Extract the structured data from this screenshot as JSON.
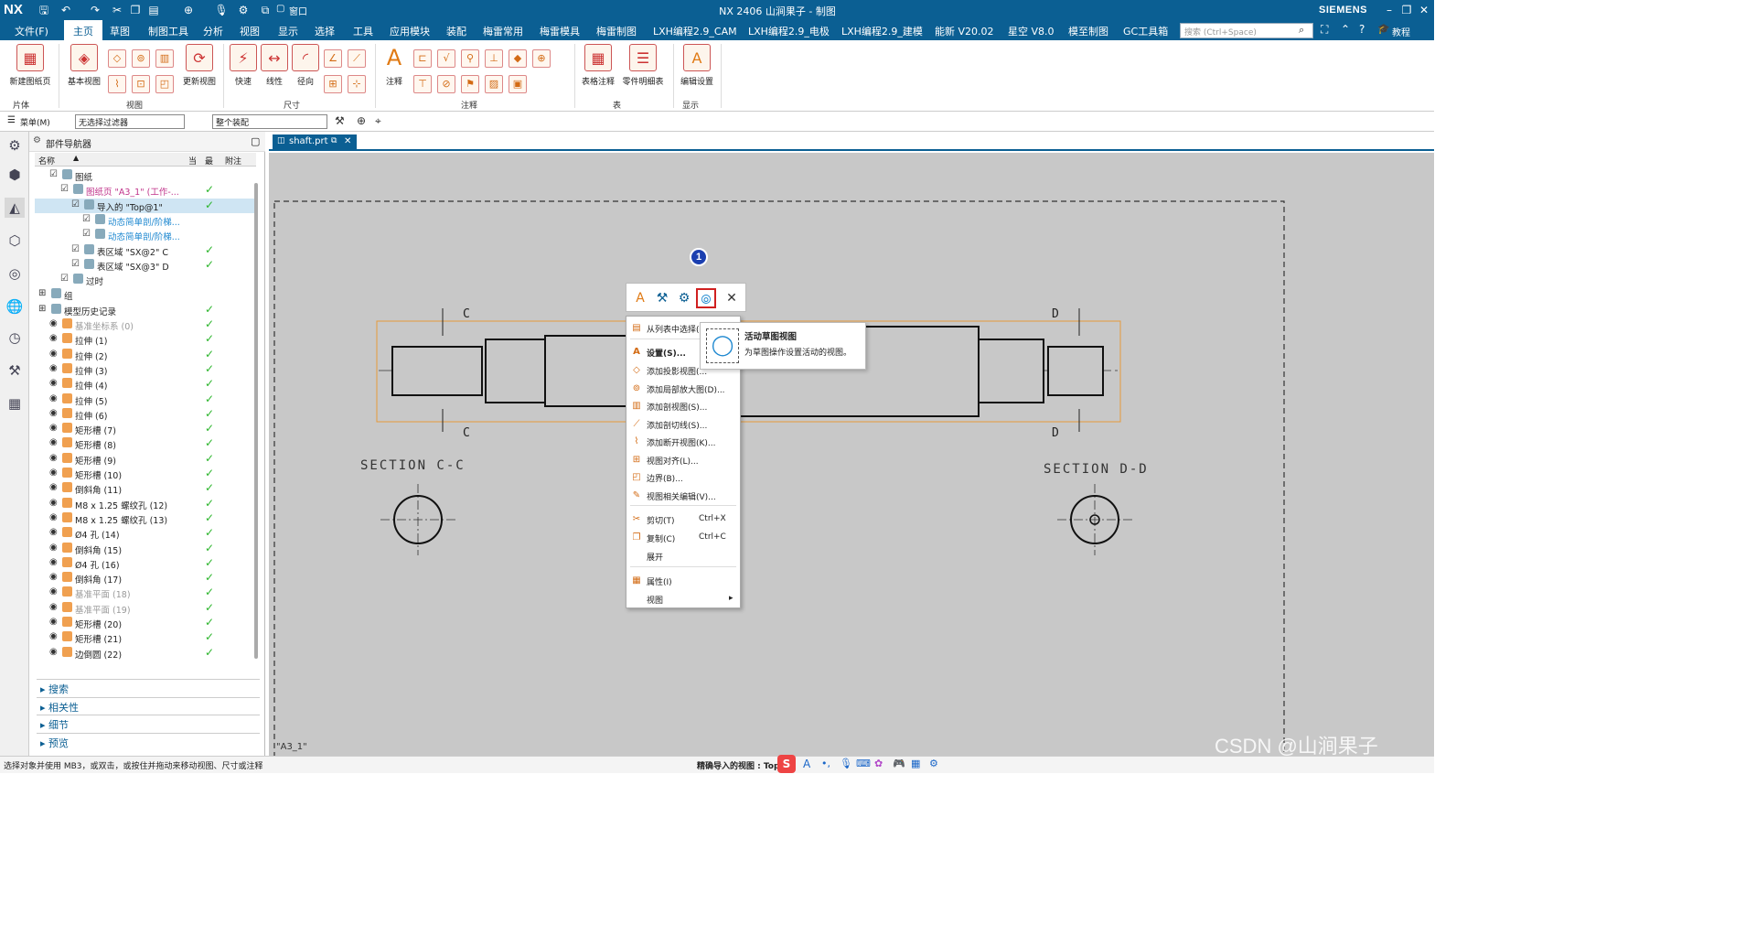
{
  "titlebar": {
    "logo": "NX",
    "title": "NX 2406 山涧果子 - 制图",
    "brand": "SIEMENS",
    "window_menu": "窗口"
  },
  "menubar": {
    "items": [
      "文件(F)",
      "主页",
      "草图",
      "制图工具",
      "分析",
      "视图",
      "显示",
      "选择",
      "工具",
      "应用模块",
      "装配",
      "梅雷常用",
      "梅雷模具",
      "梅雷制图",
      "LXH编程2.9_CAM",
      "LXH编程2.9_电极",
      "LXH编程2.9_建模",
      "能新 V20.02",
      "星空 V8.0",
      "模至制图",
      "GC工具箱"
    ],
    "active": "主页",
    "search_placeholder": "搜索 (Ctrl+Space)",
    "tutorial": "教程"
  },
  "ribbon": {
    "buttons": {
      "new_sheet": "新建图纸页",
      "base_view": "基本视图",
      "update_view": "更新视图",
      "quick": "快速",
      "linear": "线性",
      "radial": "径向",
      "note": "注释",
      "table_note": "表格注释",
      "parts_list": "零件明细表",
      "edit_settings": "编辑设置"
    },
    "groups": {
      "sheet": "片体",
      "view": "视图",
      "dimension": "尺寸",
      "annotation": "注释",
      "table": "表",
      "display": "显示"
    }
  },
  "toolrow": {
    "menu": "菜单(M)",
    "filter": "无选择过滤器",
    "scope": "整个装配"
  },
  "navigator": {
    "title": "部件导航器",
    "columns": {
      "name": "名称",
      "current": "当",
      "latest": "最",
      "notes": "附注"
    },
    "rows": [
      {
        "label": "图纸",
        "indent": 1,
        "check": false
      },
      {
        "label": "图纸页 \"A3_1\" (工作-...",
        "indent": 2,
        "check": true,
        "color": "#c0338a"
      },
      {
        "label": "导入的 \"Top@1\"",
        "indent": 3,
        "check": true,
        "selected": true
      },
      {
        "label": "动态简单剖/阶梯...",
        "indent": 4,
        "check": false,
        "color": "#1e88d0"
      },
      {
        "label": "动态简单剖/阶梯...",
        "indent": 4,
        "check": false,
        "color": "#1e88d0"
      },
      {
        "label": "表区域 \"SX@2\" C",
        "indent": 3,
        "check": true
      },
      {
        "label": "表区域 \"SX@3\" D",
        "indent": 3,
        "check": true
      },
      {
        "label": "过时",
        "indent": 2,
        "check": false
      },
      {
        "label": "组",
        "indent": 0,
        "check": false
      },
      {
        "label": "模型历史记录",
        "indent": 0,
        "check": true
      },
      {
        "label": "基准坐标系 (0)",
        "indent": 1,
        "check": true,
        "color": "#999"
      },
      {
        "label": "拉伸 (1)",
        "indent": 1,
        "check": true
      },
      {
        "label": "拉伸 (2)",
        "indent": 1,
        "check": true
      },
      {
        "label": "拉伸 (3)",
        "indent": 1,
        "check": true
      },
      {
        "label": "拉伸 (4)",
        "indent": 1,
        "check": true
      },
      {
        "label": "拉伸 (5)",
        "indent": 1,
        "check": true
      },
      {
        "label": "拉伸 (6)",
        "indent": 1,
        "check": true
      },
      {
        "label": "矩形槽 (7)",
        "indent": 1,
        "check": true
      },
      {
        "label": "矩形槽 (8)",
        "indent": 1,
        "check": true
      },
      {
        "label": "矩形槽 (9)",
        "indent": 1,
        "check": true
      },
      {
        "label": "矩形槽 (10)",
        "indent": 1,
        "check": true
      },
      {
        "label": "倒斜角 (11)",
        "indent": 1,
        "check": true
      },
      {
        "label": "M8 x 1.25 螺纹孔 (12)",
        "indent": 1,
        "check": true
      },
      {
        "label": "M8 x 1.25 螺纹孔 (13)",
        "indent": 1,
        "check": true
      },
      {
        "label": "Ø4 孔 (14)",
        "indent": 1,
        "check": true
      },
      {
        "label": "倒斜角 (15)",
        "indent": 1,
        "check": true
      },
      {
        "label": "Ø4 孔 (16)",
        "indent": 1,
        "check": true
      },
      {
        "label": "倒斜角 (17)",
        "indent": 1,
        "check": true
      },
      {
        "label": "基准平面 (18)",
        "indent": 1,
        "check": true,
        "color": "#999"
      },
      {
        "label": "基准平面 (19)",
        "indent": 1,
        "check": true,
        "color": "#999"
      },
      {
        "label": "矩形槽 (20)",
        "indent": 1,
        "check": true
      },
      {
        "label": "矩形槽 (21)",
        "indent": 1,
        "check": true
      },
      {
        "label": "边倒圆 (22)",
        "indent": 1,
        "check": true
      }
    ],
    "panels": [
      "搜索",
      "相关性",
      "细节",
      "预览"
    ]
  },
  "tab": {
    "name": "shaft.prt"
  },
  "drawing": {
    "sheet_label": "\"A3_1\"",
    "section_c": "SECTION C-C",
    "section_d": "SECTION D-D",
    "mark_c": "C",
    "mark_d": "D"
  },
  "popup": {
    "badge": "1",
    "tooltip_title": "活动草图视图",
    "tooltip_desc": "为草图操作设置活动的视图。",
    "menu": [
      {
        "label": "从列表中选择(...",
        "icon": "list-icon"
      },
      {
        "label": "设置(S)...",
        "icon": "settings-icon",
        "bold": true
      },
      {
        "label": "添加投影视图(...",
        "icon": "projected-view-icon"
      },
      {
        "label": "添加局部放大图(D)...",
        "icon": "detail-view-icon"
      },
      {
        "label": "添加剖视图(S)...",
        "icon": "section-view-icon"
      },
      {
        "label": "添加剖切线(S)...",
        "icon": "cut-line-icon"
      },
      {
        "label": "添加断开视图(K)...",
        "icon": "break-view-icon"
      },
      {
        "label": "视图对齐(L)...",
        "icon": "align-icon"
      },
      {
        "label": "边界(B)...",
        "icon": "boundary-icon"
      },
      {
        "label": "视图相关编辑(V)...",
        "icon": "view-edit-icon"
      },
      {
        "label": "剪切(T)",
        "shortcut": "Ctrl+X",
        "icon": "cut-icon"
      },
      {
        "label": "复制(C)",
        "shortcut": "Ctrl+C",
        "icon": "copy-icon"
      },
      {
        "label": "展开",
        "icon": ""
      },
      {
        "label": "属性(I)",
        "icon": "properties-icon"
      },
      {
        "label": "视图",
        "icon": "",
        "submenu": true
      }
    ]
  },
  "status": {
    "left": "选择对象并使用 MB3，或双击，或按住并拖动来移动视图、尺寸或注释",
    "right": "精确导入的视图 : Top"
  },
  "watermark": "CSDN @山涧果子"
}
